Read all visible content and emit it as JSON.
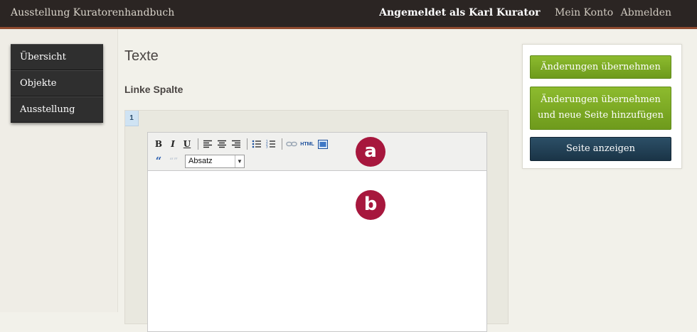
{
  "header": {
    "site_title": "Ausstellung Kuratorenhandbuch",
    "logged_in": "Angemeldet als Karl Kurator",
    "my_account": "Mein Konto",
    "logout": "Abmelden"
  },
  "sidebar": {
    "items": [
      {
        "label": "Übersicht"
      },
      {
        "label": "Objekte"
      },
      {
        "label": "Ausstellung"
      }
    ]
  },
  "main": {
    "page_title": "Texte",
    "section_title": "Linke Spalte",
    "row_number": "1"
  },
  "editor": {
    "format_select_value": "Absatz",
    "toolbar_icons": [
      "bold-icon",
      "italic-icon",
      "underline-icon",
      "align-left-icon",
      "align-center-icon",
      "align-right-icon",
      "bullet-list-icon",
      "numbered-list-icon",
      "link-icon",
      "html-icon",
      "fullscreen-icon",
      "blockquote-icon",
      "unquote-icon"
    ],
    "html_label": "HTML"
  },
  "markers": {
    "a": "a",
    "b": "b"
  },
  "actions": {
    "save": "Änderungen übernehmen",
    "save_add_line1": "Änderungen übernehmen",
    "save_add_line2": "und neue Seite hinzufügen",
    "view_page": "Seite anzeigen"
  },
  "colors": {
    "header_bg": "#2b2523",
    "accent_border": "#8f4a2e",
    "green_button": "#7aa823",
    "dark_button": "#1f3a4d",
    "marker": "#a7173d"
  }
}
